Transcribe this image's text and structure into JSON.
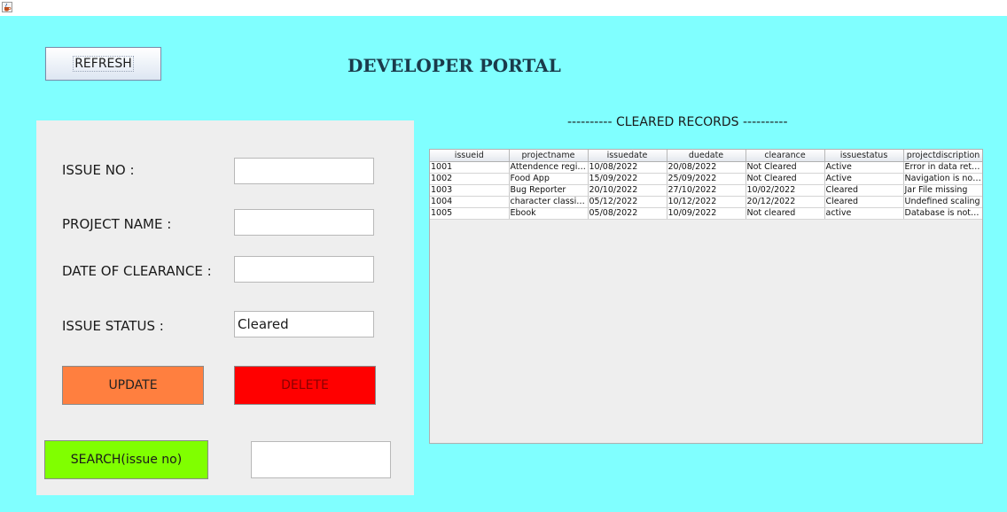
{
  "window": {
    "icon": "java-cup-icon"
  },
  "header": {
    "refresh_label": "REFRESH",
    "title": "DEVELOPER PORTAL"
  },
  "form": {
    "issue_no_label": "ISSUE NO :",
    "issue_no_value": "",
    "project_name_label": "PROJECT NAME :",
    "project_name_value": "",
    "date_of_clearance_label": "DATE OF CLEARANCE :",
    "date_of_clearance_value": "",
    "issue_status_label": "ISSUE STATUS :",
    "issue_status_value": "Cleared",
    "update_label": "UPDATE",
    "delete_label": "DELETE",
    "search_label": "SEARCH(issue no)",
    "search_value": ""
  },
  "records": {
    "heading": "---------- CLEARED RECORDS ----------",
    "columns": [
      "issueid",
      "projectname",
      "issuedate",
      "duedate",
      "clearance",
      "issuestatus",
      "projectdiscription"
    ],
    "rows": [
      [
        "1001",
        "Attendence registr...",
        "10/08/2022",
        "20/08/2022",
        "Not Cleared",
        "Active",
        "Error in data reteri..."
      ],
      [
        "1002",
        "Food App",
        "15/09/2022",
        "25/09/2022",
        "Not Cleared",
        "Active",
        " Navigation is not ..."
      ],
      [
        "1003",
        "Bug Reporter",
        "20/10/2022",
        "27/10/2022",
        "10/02/2022",
        "Cleared",
        " Jar File missing"
      ],
      [
        "1004",
        "character classifier",
        "05/12/2022",
        "10/12/2022",
        "20/12/2022",
        "Cleared",
        "Undefined scaling"
      ],
      [
        "1005",
        "Ebook",
        "05/08/2022",
        "10/09/2022",
        "Not cleared",
        "active",
        "Database is not w..."
      ]
    ]
  },
  "colors": {
    "background": "#80ffff",
    "panel": "#eeeeee",
    "update": "#ff7f3f",
    "delete": "#ff0000",
    "search": "#80ff00"
  }
}
